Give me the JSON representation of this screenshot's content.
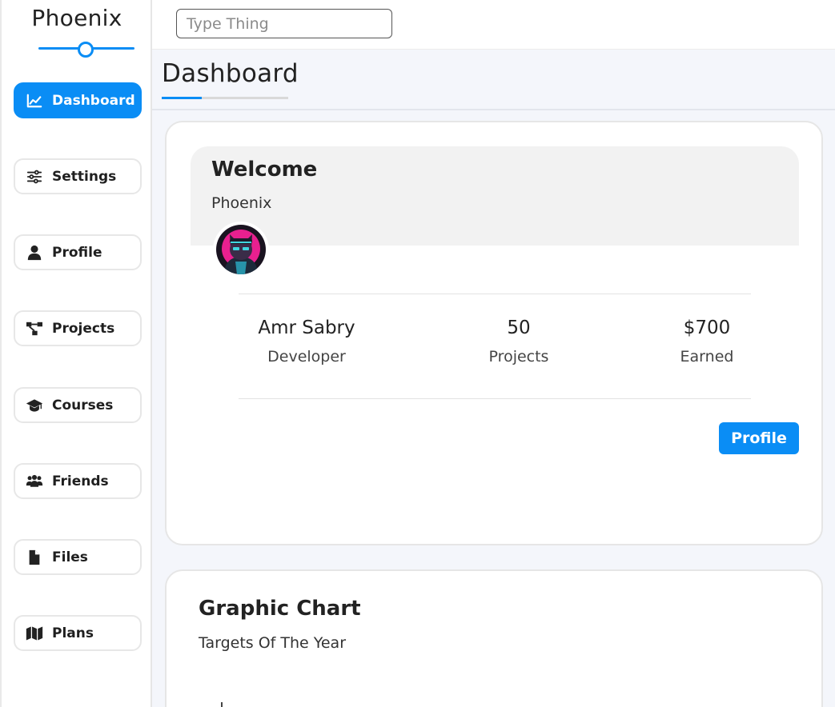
{
  "app": {
    "brand": "Phoenix"
  },
  "search": {
    "placeholder": "Type Thing"
  },
  "sidebar": {
    "items": [
      {
        "label": "Dashboard",
        "icon": "chart-line-icon",
        "active": true
      },
      {
        "label": "Settings",
        "icon": "sliders-icon",
        "active": false
      },
      {
        "label": "Profile",
        "icon": "user-icon",
        "active": false
      },
      {
        "label": "Projects",
        "icon": "diagram-project-icon",
        "active": false
      },
      {
        "label": "Courses",
        "icon": "graduation-cap-icon",
        "active": false
      },
      {
        "label": "Friends",
        "icon": "users-icon",
        "active": false
      },
      {
        "label": "Files",
        "icon": "file-icon",
        "active": false
      },
      {
        "label": "Plans",
        "icon": "map-icon",
        "active": false
      }
    ]
  },
  "page": {
    "title": "Dashboard"
  },
  "welcome": {
    "title": "Welcome",
    "subtitle": "Phoenix",
    "avatar_icon": "avatar-cat-icon",
    "stats": [
      {
        "value": "Amr Sabry",
        "label": "Developer"
      },
      {
        "value": "50",
        "label": "Projects"
      },
      {
        "value": "$700",
        "label": "Earned"
      }
    ],
    "button_label": "Profile"
  },
  "chart_card": {
    "title": "Graphic Chart",
    "subtitle": "Targets Of The Year"
  },
  "colors": {
    "accent": "#0a8df5",
    "background": "#f4f6fb"
  }
}
